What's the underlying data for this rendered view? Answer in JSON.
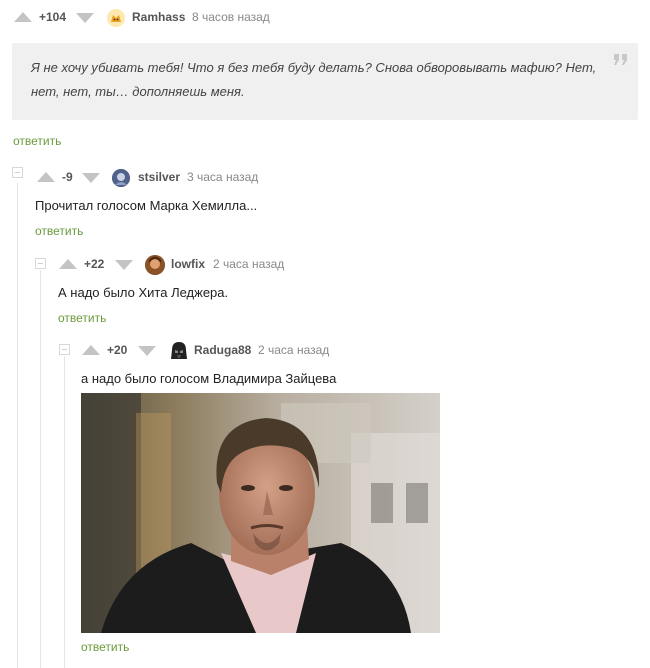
{
  "root_comment": {
    "score": "+104",
    "username": "Ramhass",
    "time": "8 часов назад",
    "quote_text": "Я не хочу убивать тебя! Что я без тебя буду делать? Снова обворовывать мафию? Нет, нет, нет, ты… дополняешь меня.",
    "reply_label": "ответить"
  },
  "comments": [
    {
      "score": "-9",
      "username": "stsilver",
      "time": "3 часа назад",
      "text": "Прочитал голосом Марка Хемилла...",
      "reply_label": "ответить"
    },
    {
      "score": "+22",
      "username": "lowfix",
      "time": "2 часа назад",
      "text": "А надо было Хита Леджера.",
      "reply_label": "ответить"
    },
    {
      "score": "+20",
      "username": "Raduga88",
      "time": "2 часа назад",
      "text": "а надо было голосом Владимира Зайцева",
      "reply_label": "ответить"
    }
  ],
  "colors": {
    "reply_link": "#6a9a3c",
    "quote_background": "#f0f0f0",
    "vote_arrow": "#c4c4c4"
  },
  "icons": [
    "vote-up-icon",
    "vote-down-icon",
    "quote-mark-icon",
    "collapse-toggle-icon"
  ]
}
